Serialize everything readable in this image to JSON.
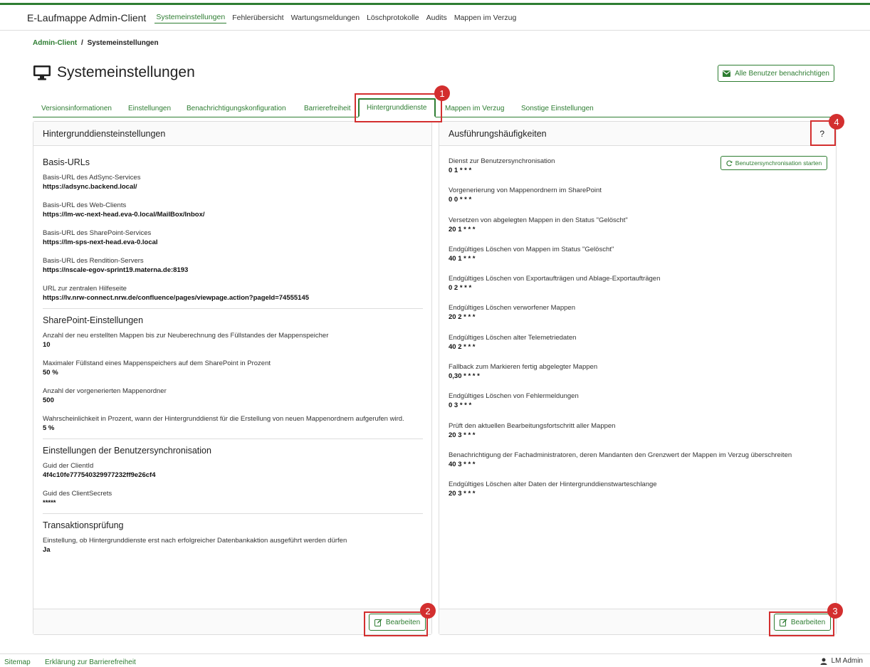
{
  "app": {
    "title": "E-Laufmappe Admin-Client",
    "accent": "#2e7d32",
    "marker_color": "#d32f2f"
  },
  "nav": {
    "items": [
      {
        "label": "Systemeinstellungen",
        "active": true
      },
      {
        "label": "Fehlerübersicht"
      },
      {
        "label": "Wartungsmeldungen"
      },
      {
        "label": "Löschprotokolle"
      },
      {
        "label": "Audits"
      },
      {
        "label": "Mappen im Verzug"
      }
    ]
  },
  "breadcrumb": {
    "root": "Admin-Client",
    "separator": "/",
    "current": "Systemeinstellungen"
  },
  "page": {
    "title": "Systemeinstellungen",
    "icon": "monitor-icon",
    "notify_button": "Alle Benutzer benachrichtigen"
  },
  "tabs": [
    {
      "label": "Versionsinformationen"
    },
    {
      "label": "Einstellungen"
    },
    {
      "label": "Benachrichtigungskonfiguration"
    },
    {
      "label": "Barrierefreiheit"
    },
    {
      "label": "Hintergrunddienste",
      "active": true
    },
    {
      "label": "Mappen im Verzug"
    },
    {
      "label": "Sonstige Einstellungen"
    }
  ],
  "markers": [
    "1",
    "2",
    "3",
    "4"
  ],
  "left_card": {
    "title": "Hintergrunddiensteinstellungen",
    "sections": [
      {
        "title": "Basis-URLs",
        "fields": [
          {
            "label": "Basis-URL des AdSync-Services",
            "value": "https://adsync.backend.local/"
          },
          {
            "label": "Basis-URL des Web-Clients",
            "value": "https://lm-wc-next-head.eva-0.local/MailBox/Inbox/"
          },
          {
            "label": "Basis-URL des SharePoint-Services",
            "value": "https://lm-sps-next-head.eva-0.local"
          },
          {
            "label": "Basis-URL des Rendition-Servers",
            "value": "https://nscale-egov-sprint19.materna.de:8193"
          },
          {
            "label": "URL zur zentralen Hilfeseite",
            "value": "https://lv.nrw-connect.nrw.de/confluence/pages/viewpage.action?pageId=74555145"
          }
        ]
      },
      {
        "title": "SharePoint-Einstellungen",
        "fields": [
          {
            "label": "Anzahl der neu erstellten Mappen bis zur Neuberechnung des Füllstandes der Mappenspeicher",
            "value": "10"
          },
          {
            "label": "Maximaler Füllstand eines Mappenspeichers auf dem SharePoint in Prozent",
            "value": "50 %"
          },
          {
            "label": "Anzahl der vorgenerierten Mappenordner",
            "value": "500"
          },
          {
            "label": "Wahrscheinlichkeit in Prozent, wann der Hintergrunddienst für die Erstellung von neuen Mappenordnern aufgerufen wird.",
            "value": "5 %"
          }
        ]
      },
      {
        "title": "Einstellungen der Benutzersynchronisation",
        "fields": [
          {
            "label": "Guid der ClientId",
            "value": "4f4c10fe777540329977232ff9e26cf4"
          },
          {
            "label": "Guid des ClientSecrets",
            "value": "*****"
          }
        ]
      },
      {
        "title": "Transaktionsprüfung",
        "fields": [
          {
            "label": "Einstellung, ob Hintergrunddienste erst nach erfolgreicher Datenbankaktion ausgeführt werden dürfen",
            "value": "Ja"
          }
        ]
      }
    ],
    "edit_button": "Bearbeiten"
  },
  "right_card": {
    "title": "Ausführungshäufigkeiten",
    "help": "?",
    "sync_button": "Benutzersynchronisation starten",
    "jobs": [
      {
        "label": "Dienst zur Benutzersynchronisation",
        "cron": "0 1 * * *"
      },
      {
        "label": "Vorgenerierung von Mappenordnern im SharePoint",
        "cron": "0 0 * * *"
      },
      {
        "label": "Versetzen von abgelegten Mappen in den Status \"Gelöscht\"",
        "cron": "20 1 * * *"
      },
      {
        "label": "Endgültiges Löschen von Mappen im Status \"Gelöscht\"",
        "cron": "40 1 * * *"
      },
      {
        "label": "Endgültiges Löschen von Exportaufträgen und Ablage-Exportaufträgen",
        "cron": "0 2 * * *"
      },
      {
        "label": "Endgültiges Löschen verworfener Mappen",
        "cron": "20 2 * * *"
      },
      {
        "label": "Endgültiges Löschen alter Telemetriedaten",
        "cron": "40 2 * * *"
      },
      {
        "label": "Fallback zum Markieren fertig abgelegter Mappen",
        "cron": "0,30 * * * *"
      },
      {
        "label": "Endgültiges Löschen von Fehlermeldungen",
        "cron": "0 3 * * *"
      },
      {
        "label": "Prüft den aktuellen Bearbeitungsfortschritt aller Mappen",
        "cron": "20 3 * * *"
      },
      {
        "label": "Benachrichtigung der Fachadministratoren, deren Mandanten den Grenzwert der Mappen im Verzug überschreiten",
        "cron": "40 3 * * *"
      },
      {
        "label": "Endgültiges Löschen alter Daten der Hintergrunddienstwarteschlange",
        "cron": "20 3 * * *"
      }
    ],
    "edit_button": "Bearbeiten"
  },
  "footer": {
    "sitemap": "Sitemap",
    "accessibility": "Erklärung zur Barrierefreiheit",
    "user": "LM Admin"
  }
}
